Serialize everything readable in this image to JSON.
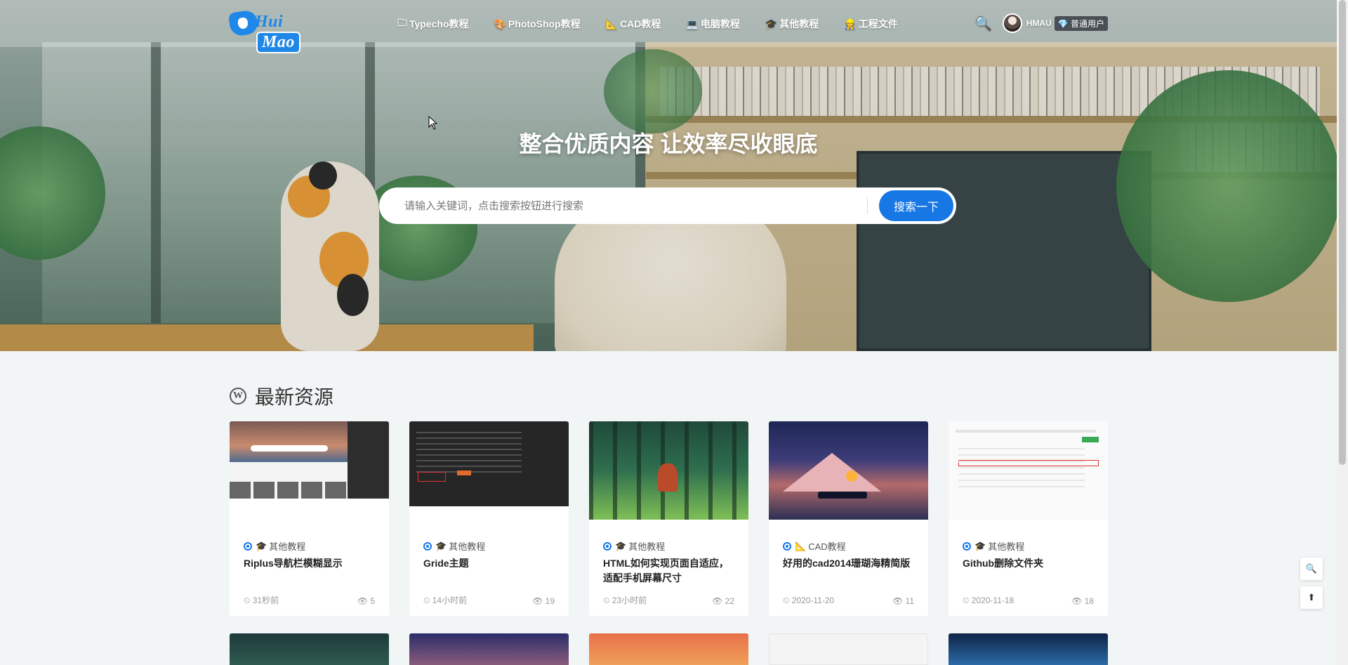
{
  "brand": {
    "logo_text_a": "Hui",
    "logo_text_b": "Mao"
  },
  "nav": {
    "items": [
      {
        "icon": "folder-icon",
        "glyph": "🗀",
        "label": "Typecho教程"
      },
      {
        "icon": "palette-icon",
        "glyph": "🎨",
        "label": "PhotoShop教程"
      },
      {
        "icon": "triangle-ruler-icon",
        "glyph": "📐",
        "label": "CAD教程"
      },
      {
        "icon": "laptop-icon",
        "glyph": "💻",
        "label": "电脑教程"
      },
      {
        "icon": "cap-icon",
        "glyph": "🎓",
        "label": "其他教程"
      },
      {
        "icon": "worker-icon",
        "glyph": "👷",
        "label": "工程文件"
      }
    ],
    "user": {
      "name": "HMAU",
      "badge": "💎 普通用户"
    }
  },
  "hero": {
    "title": "整合优质内容 让效率尽收眼底",
    "search_placeholder": "请输入关键词，点击搜索按钮进行搜索",
    "search_value": "",
    "search_button": "搜索一下"
  },
  "section": {
    "title": "最新资源"
  },
  "cards": [
    {
      "category": "其他教程",
      "cat_glyph": "🎓",
      "title": "Riplus导航栏模糊显示",
      "time": "31秒前",
      "views": "5"
    },
    {
      "category": "其他教程",
      "cat_glyph": "🎓",
      "title": "Gride主题",
      "time": "14小时前",
      "views": "19"
    },
    {
      "category": "其他教程",
      "cat_glyph": "🎓",
      "title": "HTML如何实现页面自适应，适配手机屏幕尺寸",
      "time": "23小时前",
      "views": "22"
    },
    {
      "category": "CAD教程",
      "cat_glyph": "📐",
      "title": "好用的cad2014珊瑚海精简版",
      "time": "2020-11-20",
      "views": "11"
    },
    {
      "category": "其他教程",
      "cat_glyph": "🎓",
      "title": "Github删除文件夹",
      "time": "2020-11-18",
      "views": "18"
    }
  ],
  "icons": {
    "search": "🔍",
    "clock": "⏲",
    "eye": "👁",
    "float_search": "🔍",
    "float_top": "⬆"
  },
  "colors": {
    "accent": "#1677e5",
    "page_bg": "#f1f5f6"
  }
}
